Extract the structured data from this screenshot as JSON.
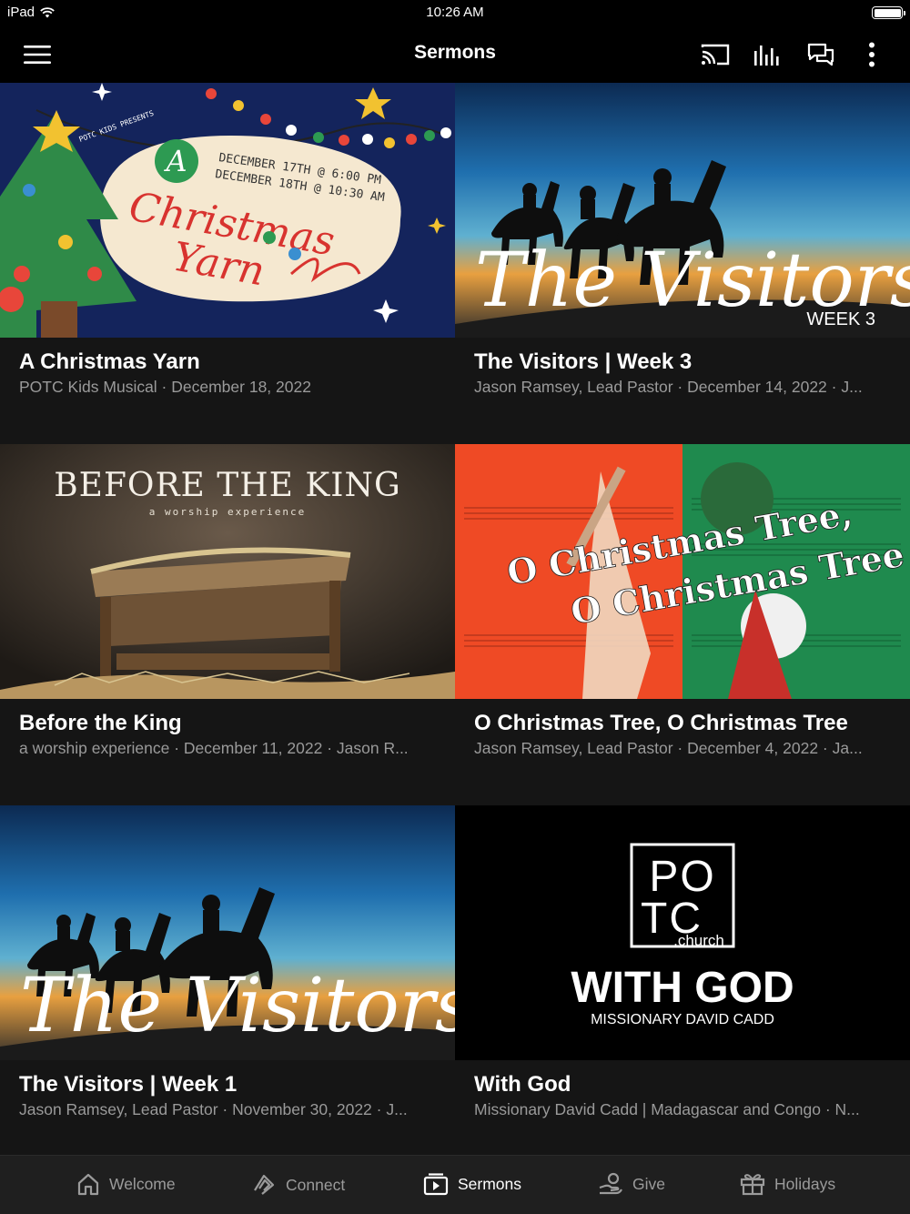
{
  "status_bar": {
    "device": "iPad",
    "time": "10:26 AM"
  },
  "header": {
    "title": "Sermons"
  },
  "sermons": [
    {
      "title": "A Christmas Yarn",
      "subtitle": "POTC Kids Musical · December 18, 2022",
      "art": {
        "presents": "POTC KIDS PRESENTS",
        "dates_1": "DECEMBER 17TH @ 6:00 PM",
        "dates_2": "DECEMBER 18TH @ 10:30 AM",
        "letter": "A",
        "line_1": "Christmas",
        "line_2": "Yarn"
      }
    },
    {
      "title": "The Visitors | Week 3",
      "subtitle": "Jason Ramsey, Lead Pastor · December 14, 2022 · J...",
      "art": {
        "script": "The Visitors",
        "week": "WEEK 3"
      }
    },
    {
      "title": "Before the King",
      "subtitle": "a worship experience · December 11, 2022 · Jason R...",
      "art": {
        "heading": "BEFORE THE KING",
        "tagline": "a worship experience"
      }
    },
    {
      "title": "O Christmas Tree, O Christmas Tree",
      "subtitle": "Jason Ramsey, Lead Pastor · December 4, 2022 · Ja...",
      "art": {
        "line_1": "O Christmas Tree,",
        "line_2": "O Christmas Tree"
      }
    },
    {
      "title": "The Visitors | Week 1",
      "subtitle": "Jason Ramsey, Lead Pastor · November 30, 2022 · J...",
      "art": {
        "script": "The Visitors"
      }
    },
    {
      "title": "With God",
      "subtitle": "Missionary David Cadd | Madagascar and Congo · N...",
      "art": {
        "logo_1": "PO",
        "logo_2": "TC",
        "logo_3": ".church",
        "heading": "WITH GOD",
        "tagline": "MISSIONARY DAVID CADD"
      }
    }
  ],
  "tab_bar": [
    {
      "label": "Welcome",
      "icon": "home-icon"
    },
    {
      "label": "Connect",
      "icon": "connect-icon"
    },
    {
      "label": "Sermons",
      "icon": "sermons-icon",
      "active": true
    },
    {
      "label": "Give",
      "icon": "give-icon"
    },
    {
      "label": "Holidays",
      "icon": "gift-icon"
    }
  ],
  "colors": {
    "background": "#000000",
    "card": "#151515",
    "subtitle": "#9a9a9a",
    "tab_bar": "#1f1f1f"
  }
}
